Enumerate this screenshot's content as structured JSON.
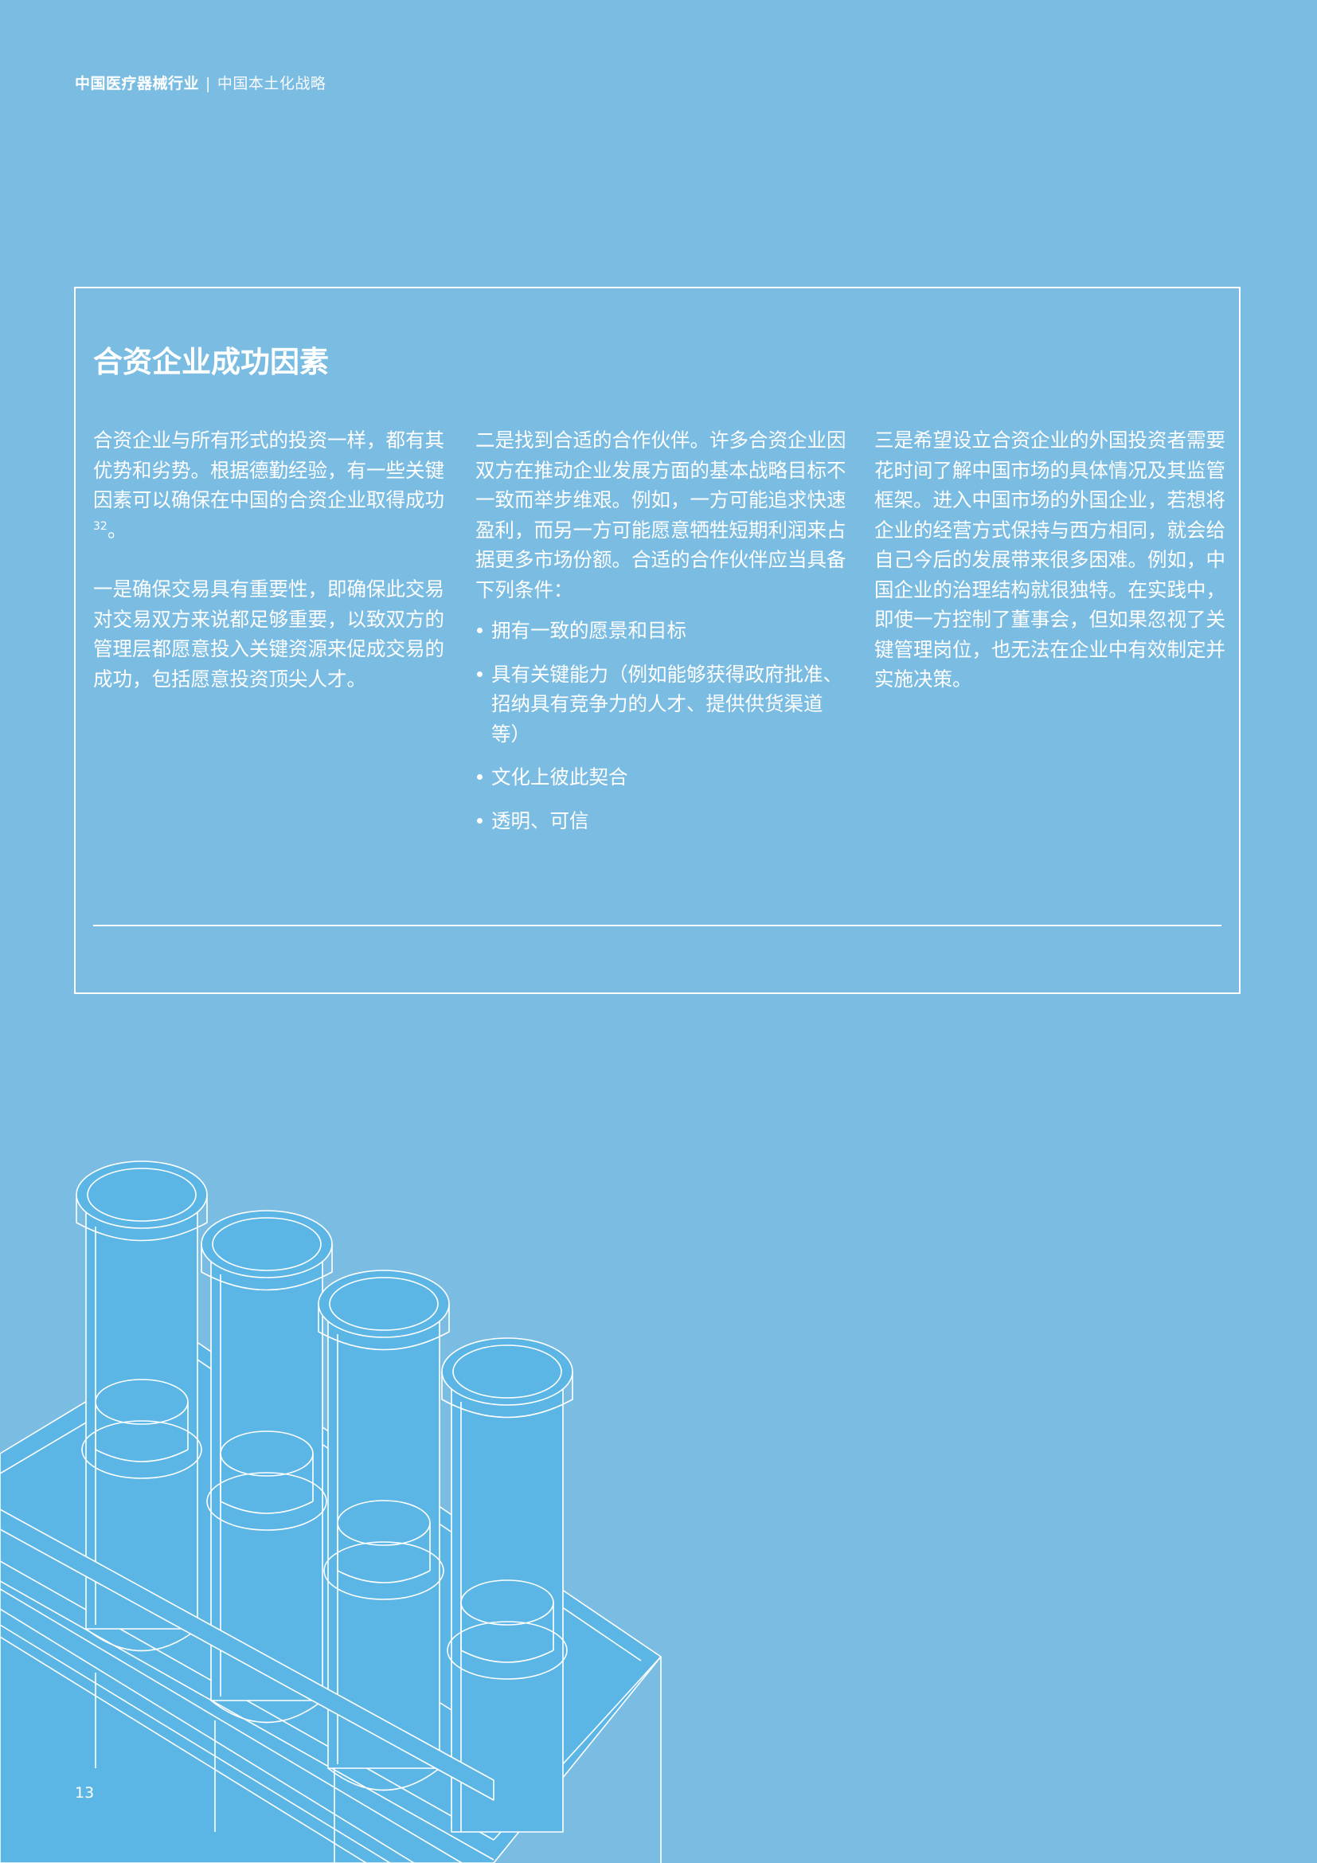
{
  "header": {
    "title": "中国医疗器械行业",
    "separator": "|",
    "subtitle": "中国本土化战略"
  },
  "box": {
    "title": "合资企业成功因素",
    "col1": {
      "p1_text": "合资企业与所有形式的投资一样，都有其优势和劣势。根据德勤经验，有一些关键因素可以确保在中国的合资企业取得成功",
      "p1_sup": "32",
      "p1_end": "。",
      "p2": "一是确保交易具有重要性，即确保此交易对交易双方来说都足够重要，以致双方的管理层都愿意投入关键资源来促成交易的成功，包括愿意投资顶尖人才。"
    },
    "col2": {
      "p1": "二是找到合适的合作伙伴。许多合资企业因双方在推动企业发展方面的基本战略目标不一致而举步维艰。例如，一方可能追求快速盈利，而另一方可能愿意牺牲短期利润来占据更多市场份额。合适的合作伙伴应当具备下列条件：",
      "bullets": [
        "拥有一致的愿景和目标",
        "具有关键能力（例如能够获得政府批准、招纳具有竞争力的人才、提供供货渠道等）",
        "文化上彼此契合",
        "透明、可信"
      ]
    },
    "col3": {
      "p1": "三是希望设立合资企业的外国投资者需要花时间了解中国市场的具体情况及其监管框架。进入中国市场的外国企业，若想将企业的经营方式保持与西方相同，就会给自己今后的发展带来很多困难。例如，中国企业的治理结构就很独特。在实践中，即使一方控制了董事会，但如果忽视了关键管理岗位，也无法在企业中有效制定并实施决策。"
    }
  },
  "illustration": {
    "icon": "test-tube-rack-icon",
    "fill": "#5bb6e6",
    "stroke": "#ffffff"
  },
  "page_number": "13",
  "colors": {
    "background": "#7abce2",
    "text": "#ffffff"
  }
}
